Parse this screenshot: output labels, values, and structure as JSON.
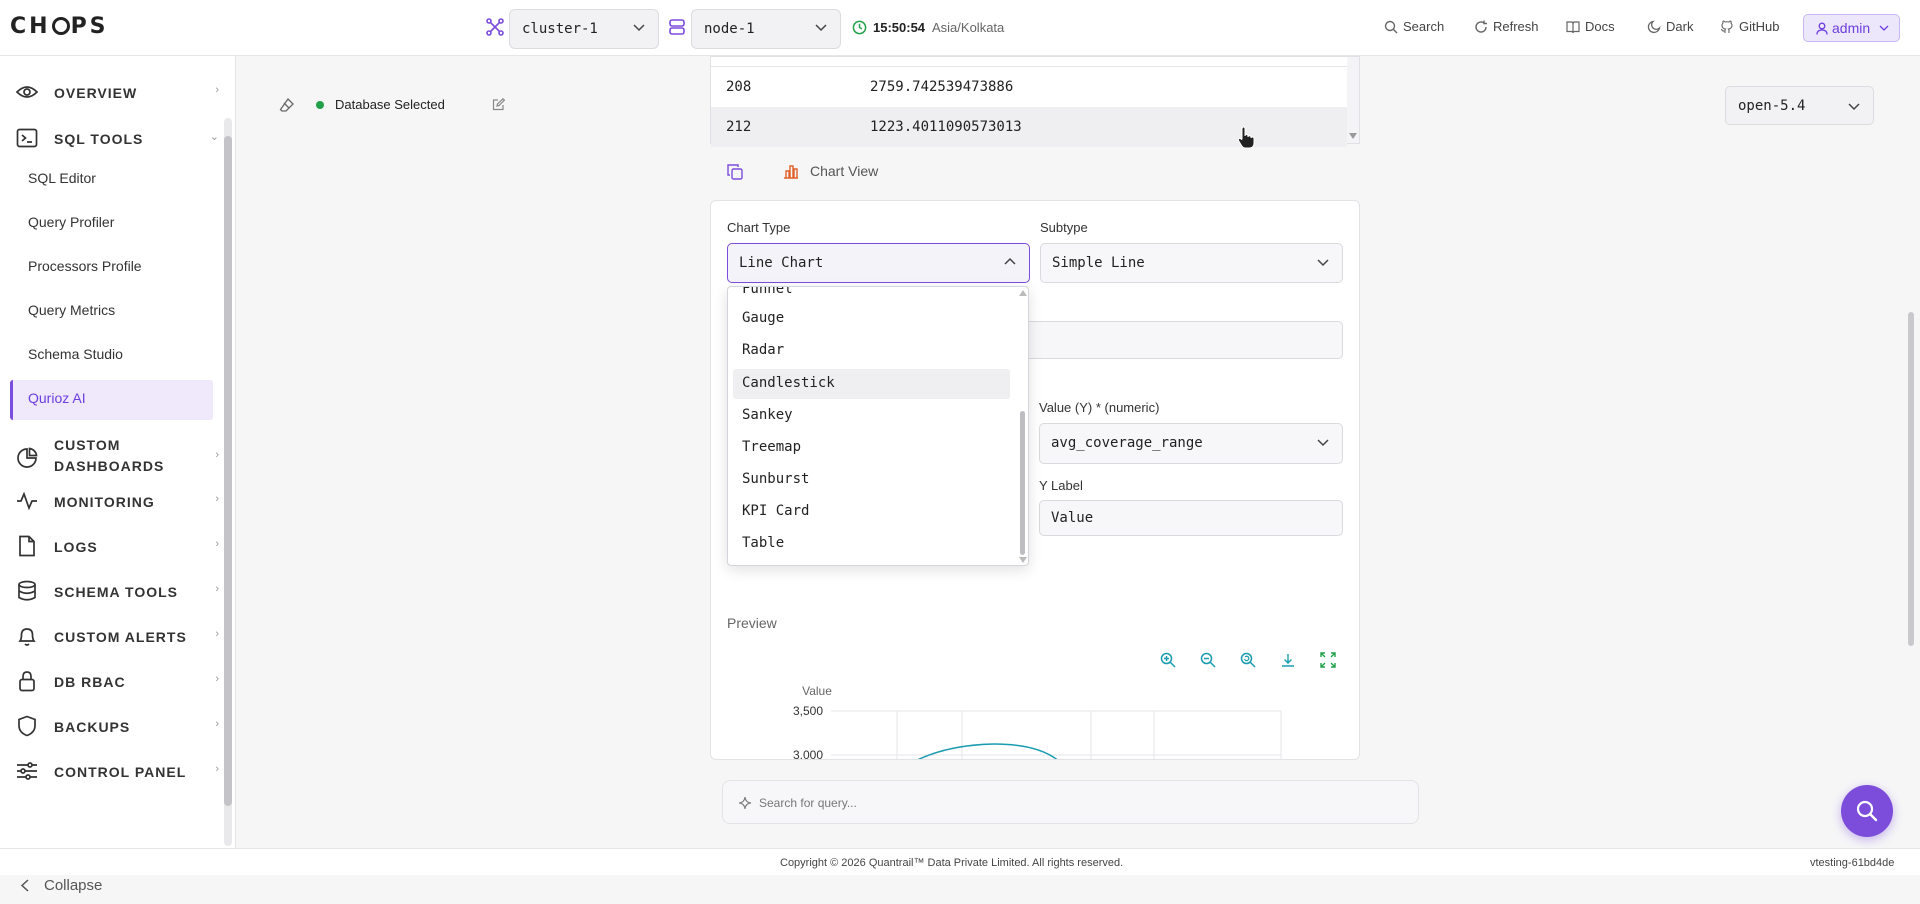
{
  "app": {
    "logo": "CH◯PS"
  },
  "topbar": {
    "cluster": "cluster-1",
    "node": "node-1",
    "time": "15:50:54",
    "timezone": "Asia/Kolkata",
    "links": {
      "search": "Search",
      "refresh": "Refresh",
      "docs": "Docs",
      "dark": "Dark",
      "github": "GitHub"
    },
    "user": "admin"
  },
  "sidebar": {
    "overview": "OVERVIEW",
    "sql_tools": "SQL TOOLS",
    "sql_sub": [
      "SQL Editor",
      "Query Profiler",
      "Processors Profile",
      "Query Metrics",
      "Schema Studio",
      "Qurioz AI"
    ],
    "custom_dashboards_1": "CUSTOM",
    "custom_dashboards_2": "DASHBOARDS",
    "monitoring": "MONITORING",
    "logs": "LOGS",
    "schema_tools": "SCHEMA TOOLS",
    "custom_alerts": "CUSTOM ALERTS",
    "db_rbac": "DB RBAC",
    "backups": "BACKUPS",
    "control_panel": "CONTROL PANEL",
    "collapse": "Collapse"
  },
  "status": {
    "db_selected": "Database Selected",
    "version": "open-5.4"
  },
  "results": {
    "rows": [
      {
        "id": "208",
        "value": "2759.742539473886"
      },
      {
        "id": "212",
        "value": "1223.4011090573013"
      }
    ]
  },
  "chart_view": {
    "label": "Chart View"
  },
  "form": {
    "chart_type_label": "Chart Type",
    "chart_type_value": "Line Chart",
    "subtype_label": "Subtype",
    "subtype_value": "Simple Line",
    "value_y_label": "Value (Y) * (numeric)",
    "value_y_value": "avg_coverage_range",
    "y_label_label": "Y Label",
    "y_label_value": "Value",
    "preview_label": "Preview"
  },
  "dropdown": {
    "partial_top": "Funnel",
    "options": [
      "Gauge",
      "Radar",
      "Candlestick",
      "Sankey",
      "Treemap",
      "Sunburst",
      "KPI Card",
      "Table"
    ],
    "highlighted": "Candlestick"
  },
  "preview_chart": {
    "y_title": "Value",
    "ticks": [
      "3,500",
      "3,000"
    ]
  },
  "query_search": {
    "placeholder": "Search for query..."
  },
  "footer": {
    "copyright": "Copyright © 2026 Quantrail™ Data Private Limited. All rights reserved.",
    "build": "vtesting-61bd4de"
  },
  "colors": {
    "accent": "#7c4ddb",
    "teal": "#1a9bb0",
    "green": "#22a04a"
  }
}
